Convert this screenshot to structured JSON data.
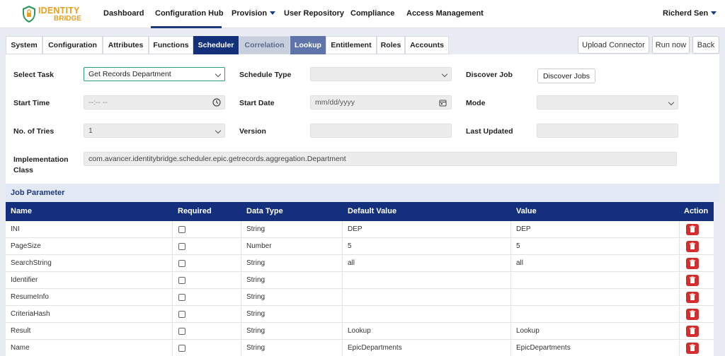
{
  "brand": {
    "line1": "IDENTITY",
    "line2": "BRIDGE"
  },
  "nav": {
    "items": [
      "Dashboard",
      "Configuration Hub",
      "Provision",
      "User Repository",
      "Compliance",
      "Access Management"
    ],
    "user": "Richerd Sen"
  },
  "tabs": [
    "System",
    "Configuration",
    "Attributes",
    "Functions",
    "Scheduler",
    "Correlation",
    "Lookup",
    "Entitlement",
    "Roles",
    "Accounts"
  ],
  "toolbar": {
    "upload": "Upload Connector",
    "run": "Run now",
    "back": "Back"
  },
  "form": {
    "select_task_label": "Select Task",
    "select_task_value": "Get Records Department",
    "schedule_type_label": "Schedule Type",
    "schedule_type_value": "",
    "discover_job_label": "Discover Job",
    "discover_jobs_button": "Discover Jobs",
    "start_time_label": "Start Time",
    "start_time_value": "--:-- --",
    "start_date_label": "Start Date",
    "start_date_value": "mm/dd/yyyy",
    "mode_label": "Mode",
    "mode_value": "",
    "tries_label": "No. of Tries",
    "tries_value": "1",
    "version_label": "Version",
    "version_value": "",
    "last_updated_label": "Last Updated",
    "last_updated_value": "",
    "impl_label_1": "Implementation",
    "impl_label_2": "Class",
    "impl_value": "com.avancer.identitybridge.scheduler.epic.getrecords.aggregation.Department"
  },
  "job_parameter": {
    "title": "Job Parameter",
    "columns": [
      "Name",
      "Required",
      "Data Type",
      "Default Value",
      "Value",
      "Action"
    ],
    "rows": [
      {
        "name": "INI",
        "type": "String",
        "default": "DEP",
        "value": "DEP"
      },
      {
        "name": "PageSize",
        "type": "Number",
        "default": "5",
        "value": "5"
      },
      {
        "name": "SearchString",
        "type": "String",
        "default": "all",
        "value": "all"
      },
      {
        "name": "Identifier",
        "type": "String",
        "default": "",
        "value": ""
      },
      {
        "name": "ResumeInfo",
        "type": "String",
        "default": "",
        "value": ""
      },
      {
        "name": "CriteriaHash",
        "type": "String",
        "default": "",
        "value": ""
      },
      {
        "name": "Result",
        "type": "String",
        "default": "Lookup",
        "value": "Lookup"
      },
      {
        "name": "Name",
        "type": "String",
        "default": "EpicDepartments",
        "value": "EpicDepartments"
      }
    ]
  },
  "colors": {
    "primary": "#14307c",
    "accent": "#e8a021",
    "danger": "#d32f2f"
  }
}
